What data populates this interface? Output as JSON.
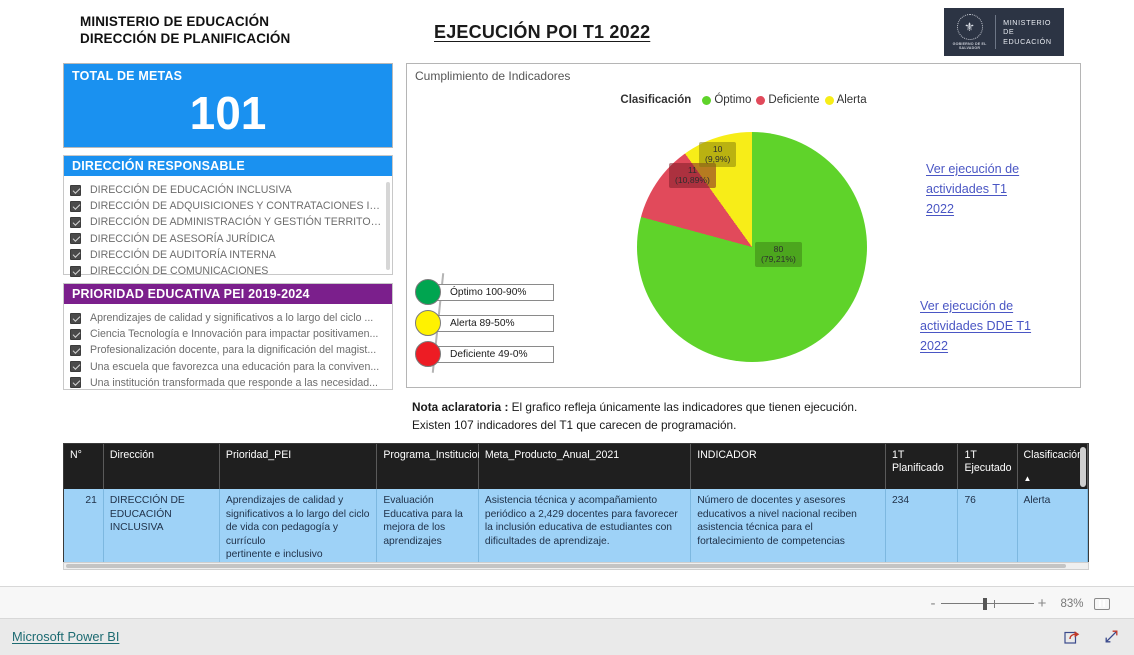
{
  "header": {
    "ministry_line1": "MINISTERIO DE EDUCACIÓN",
    "ministry_line2": "DIRECCIÓN DE PLANIFICACIÓN",
    "title": "EJECUCIÓN  POI T1 2022 ",
    "logo": {
      "crest_glyph": "⚜",
      "gov_text": "GOBIERNO DE EL SALVADOR",
      "text_line1": "MINISTERIO",
      "text_line2": "DE EDUCACIÓN"
    }
  },
  "kpi": {
    "title": "TOTAL DE METAS",
    "value": "101",
    "color": "#1a91f0"
  },
  "slicer_direccion": {
    "title": "DIRECCIÓN RESPONSABLE",
    "header_color": "#1a91f0",
    "items": [
      "DIRECCIÓN DE EDUCACIÓN INCLUSIVA",
      "DIRECCIÓN DE ADQUISICIONES Y CONTRATACIONES INSTIT...",
      "DIRECCIÓN DE ADMINISTRACIÓN Y GESTIÓN TERRITORIAL",
      "DIRECCIÓN DE ASESORÍA JURÍDICA",
      "DIRECCIÓN DE AUDITORÍA INTERNA",
      "DIRECCIÓN DE COMUNICACIONES"
    ]
  },
  "slicer_prioridad": {
    "title": "PRIORIDAD EDUCATIVA PEI 2019-2024",
    "header_color": "#7b1f8c",
    "items": [
      "Aprendizajes de calidad y significativos a lo largo del ciclo ...",
      "Ciencia Tecnología e Innovación para impactar positivamen...",
      "Profesionalización docente, para la dignificación del magist...",
      "Una escuela que favorezca una educación para la conviven...",
      "Una institución transformada que responde a las necesidad..."
    ]
  },
  "chart_panel": {
    "caption": "Cumplimiento de Indicadores",
    "legend_title": "Clasificación"
  },
  "chart_data": {
    "type": "pie",
    "title": "Cumplimiento de Indicadores",
    "legend_title": "Clasificación",
    "legend_position": "top-center",
    "categories": [
      "Óptimo",
      "Deficiente",
      "Alerta"
    ],
    "values": [
      80,
      11,
      10
    ],
    "percentages": [
      "79,21%",
      "9,9%",
      "10,89%"
    ],
    "colors": [
      "#5fd32a",
      "#e14a5b",
      "#f7ed18"
    ],
    "labels": [
      {
        "name": "Óptimo",
        "value": 80,
        "pct": "79,21%",
        "text": "80\n(79,21%)"
      },
      {
        "name": "Deficiente",
        "value": 11,
        "pct": "10,89%",
        "text": "11\n(10,89%)"
      },
      {
        "name": "Alerta",
        "value": 10,
        "pct": "9,9%",
        "text": "10\n(9,9%)"
      }
    ],
    "total": 101
  },
  "traffic_light": {
    "rows": [
      {
        "label": "Óptimo 100-90%",
        "color": "#00a550"
      },
      {
        "label": "Alerta 89-50%",
        "color": "#fff200"
      },
      {
        "label": "Deficiente 49-0%",
        "color": "#ed1c24"
      }
    ]
  },
  "links": {
    "link1": "Ver ejecución de actividades T1 2022",
    "link1_lines": [
      "Ver ejecución de ",
      "actividades T1 ",
      "2022"
    ],
    "link2": "Ver ejecución de actividades DDE  T1 2022",
    "link2_lines": [
      "Ver ejecución de ",
      "actividades DDE  T1 ",
      "2022"
    ]
  },
  "note": {
    "label": "Nota aclaratoria :",
    "line1": " El grafico refleja únicamente las indicadores  que  tienen ejecución.",
    "line2": "Existen 107 indicadores  del T1 que carecen de programación."
  },
  "table": {
    "columns": [
      "N°",
      "Dirección",
      "Prioridad_PEI",
      "Programa_Institucional",
      "Meta_Producto_Anual_2021",
      "INDICADOR",
      "1T Planificado",
      "1T Ejecutado",
      "Clasificación"
    ],
    "sort_column": "Clasificación",
    "sort_direction": "asc",
    "sort_glyph": "▲",
    "rows": [
      {
        "n": "21",
        "direccion": "DIRECCIÓN DE EDUCACIÓN INCLUSIVA",
        "prioridad_pei": "Aprendizajes de calidad y significativos a lo largo del ciclo de vida con pedagogía y currículo\npertinente e inclusivo",
        "programa_institucional": "Evaluación Educativa para la mejora de los aprendizajes",
        "meta_producto": "Asistencia técnica y acompañamiento periódico a 2,429 docentes para favorecer la inclusión educativa de estudiantes con dificultades de aprendizaje.",
        "indicador": "Número de docentes y asesores educativos a nivel nacional reciben asistencia técnica para el fortalecimiento de competencias",
        "planificado": "234",
        "ejecutado": "76",
        "clasificacion": "Alerta"
      }
    ]
  },
  "statusbar": {
    "zoom_minus": "-",
    "zoom_plus": "+",
    "zoom_level": "83%",
    "fit_icon": "fit-to-page-icon"
  },
  "footer": {
    "brand": "Microsoft Power BI",
    "share_icon": "share-icon",
    "fullscreen_icon": "fullscreen-icon"
  }
}
